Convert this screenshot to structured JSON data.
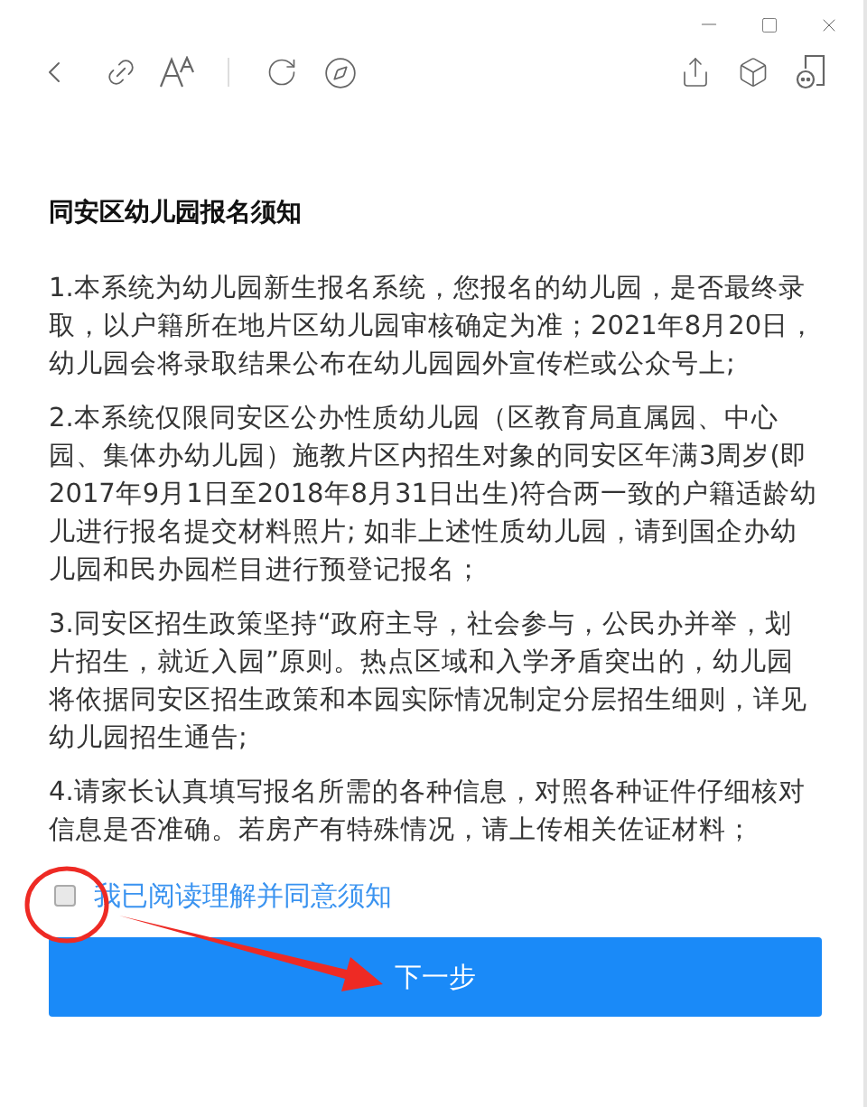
{
  "notice": {
    "title": "同安区幼儿园报名须知",
    "paragraphs": [
      "1.本系统为幼儿园新生报名系统，您报名的幼儿园，是否最终录取，以户籍所在地片区幼儿园审核确定为准；2021年8月20日，幼儿园会将录取结果公布在幼儿园园外宣传栏或公众号上;",
      "2.本系统仅限同安区公办性质幼儿园（区教育局直属园、中心园、集体办幼儿园）施教片区内招生对象的同安区年满3周岁(即2017年9月1日至2018年8月31日出生)符合两一致的户籍适龄幼儿进行报名提交材料照片; 如非上述性质幼儿园，请到国企办幼儿园和民办园栏目进行预登记报名；",
      "3.同安区招生政策坚持“政府主导，社会参与，公民办并举，划片招生，就近入园”原则。热点区域和入学矛盾突出的，幼儿园将依据同安区招生政策和本园实际情况制定分层招生细则，详见幼儿园招生通告;",
      "4.请家长认真填写报名所需的各种信息，对照各种证件仔细核对信息是否准确。若房产有特殊情况，请上传相关佐证材料；"
    ]
  },
  "agree": {
    "label": "我已阅读理解并同意须知",
    "checked": false
  },
  "next_button": {
    "label": "下一步"
  }
}
